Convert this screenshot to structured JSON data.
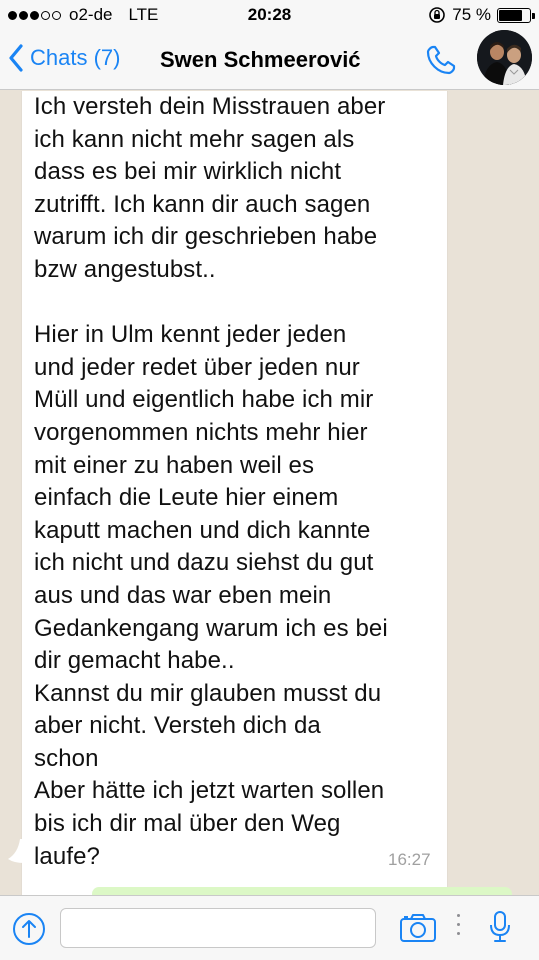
{
  "status_bar": {
    "carrier": "o2-de",
    "network": "LTE",
    "time": "20:28",
    "battery": "75 %",
    "battery_level": 0.75,
    "signal_dots_filled": 3,
    "signal_dots_total": 5
  },
  "header": {
    "back_label": "Chats (7)",
    "contact_name": "Swen Schmeerović",
    "call_icon": "phone-icon",
    "avatar_icon": "avatar-photo"
  },
  "message": {
    "text": "Ich versteh dein Misstrauen aber\nich kann nicht mehr sagen als\ndass es bei mir wirklich nicht\nzutrifft. Ich kann dir auch sagen\nwarum ich dir geschrieben habe\nbzw angestubst..\n\nHier in Ulm kennt jeder jeden\nund jeder redet über jeden nur\nMüll und eigentlich habe ich mir\nvorgenommen nichts mehr hier\nmit einer zu haben weil es\neinfach die Leute hier einem\nkaputt machen und dich kannte\nich nicht und dazu siehst du gut\naus und das war eben mein\nGedankengang warum ich es bei\ndir gemacht habe..\nKannst du mir glauben musst du\naber nicht. Versteh dich da\nschon\nAber hätte ich jetzt warten sollen\nbis ich dir mal über den Weg\nlaufe?",
    "time": "16:27"
  },
  "input_bar": {
    "placeholder": "",
    "value": "",
    "icons": [
      "upload-icon",
      "camera-icon",
      "more-icon",
      "microphone-icon"
    ]
  },
  "colors": {
    "accent": "#1a84f4",
    "chat_background": "#e9e2d7",
    "bubble_incoming": "#ffffff",
    "bubble_outgoing": "#dcf8c6"
  }
}
